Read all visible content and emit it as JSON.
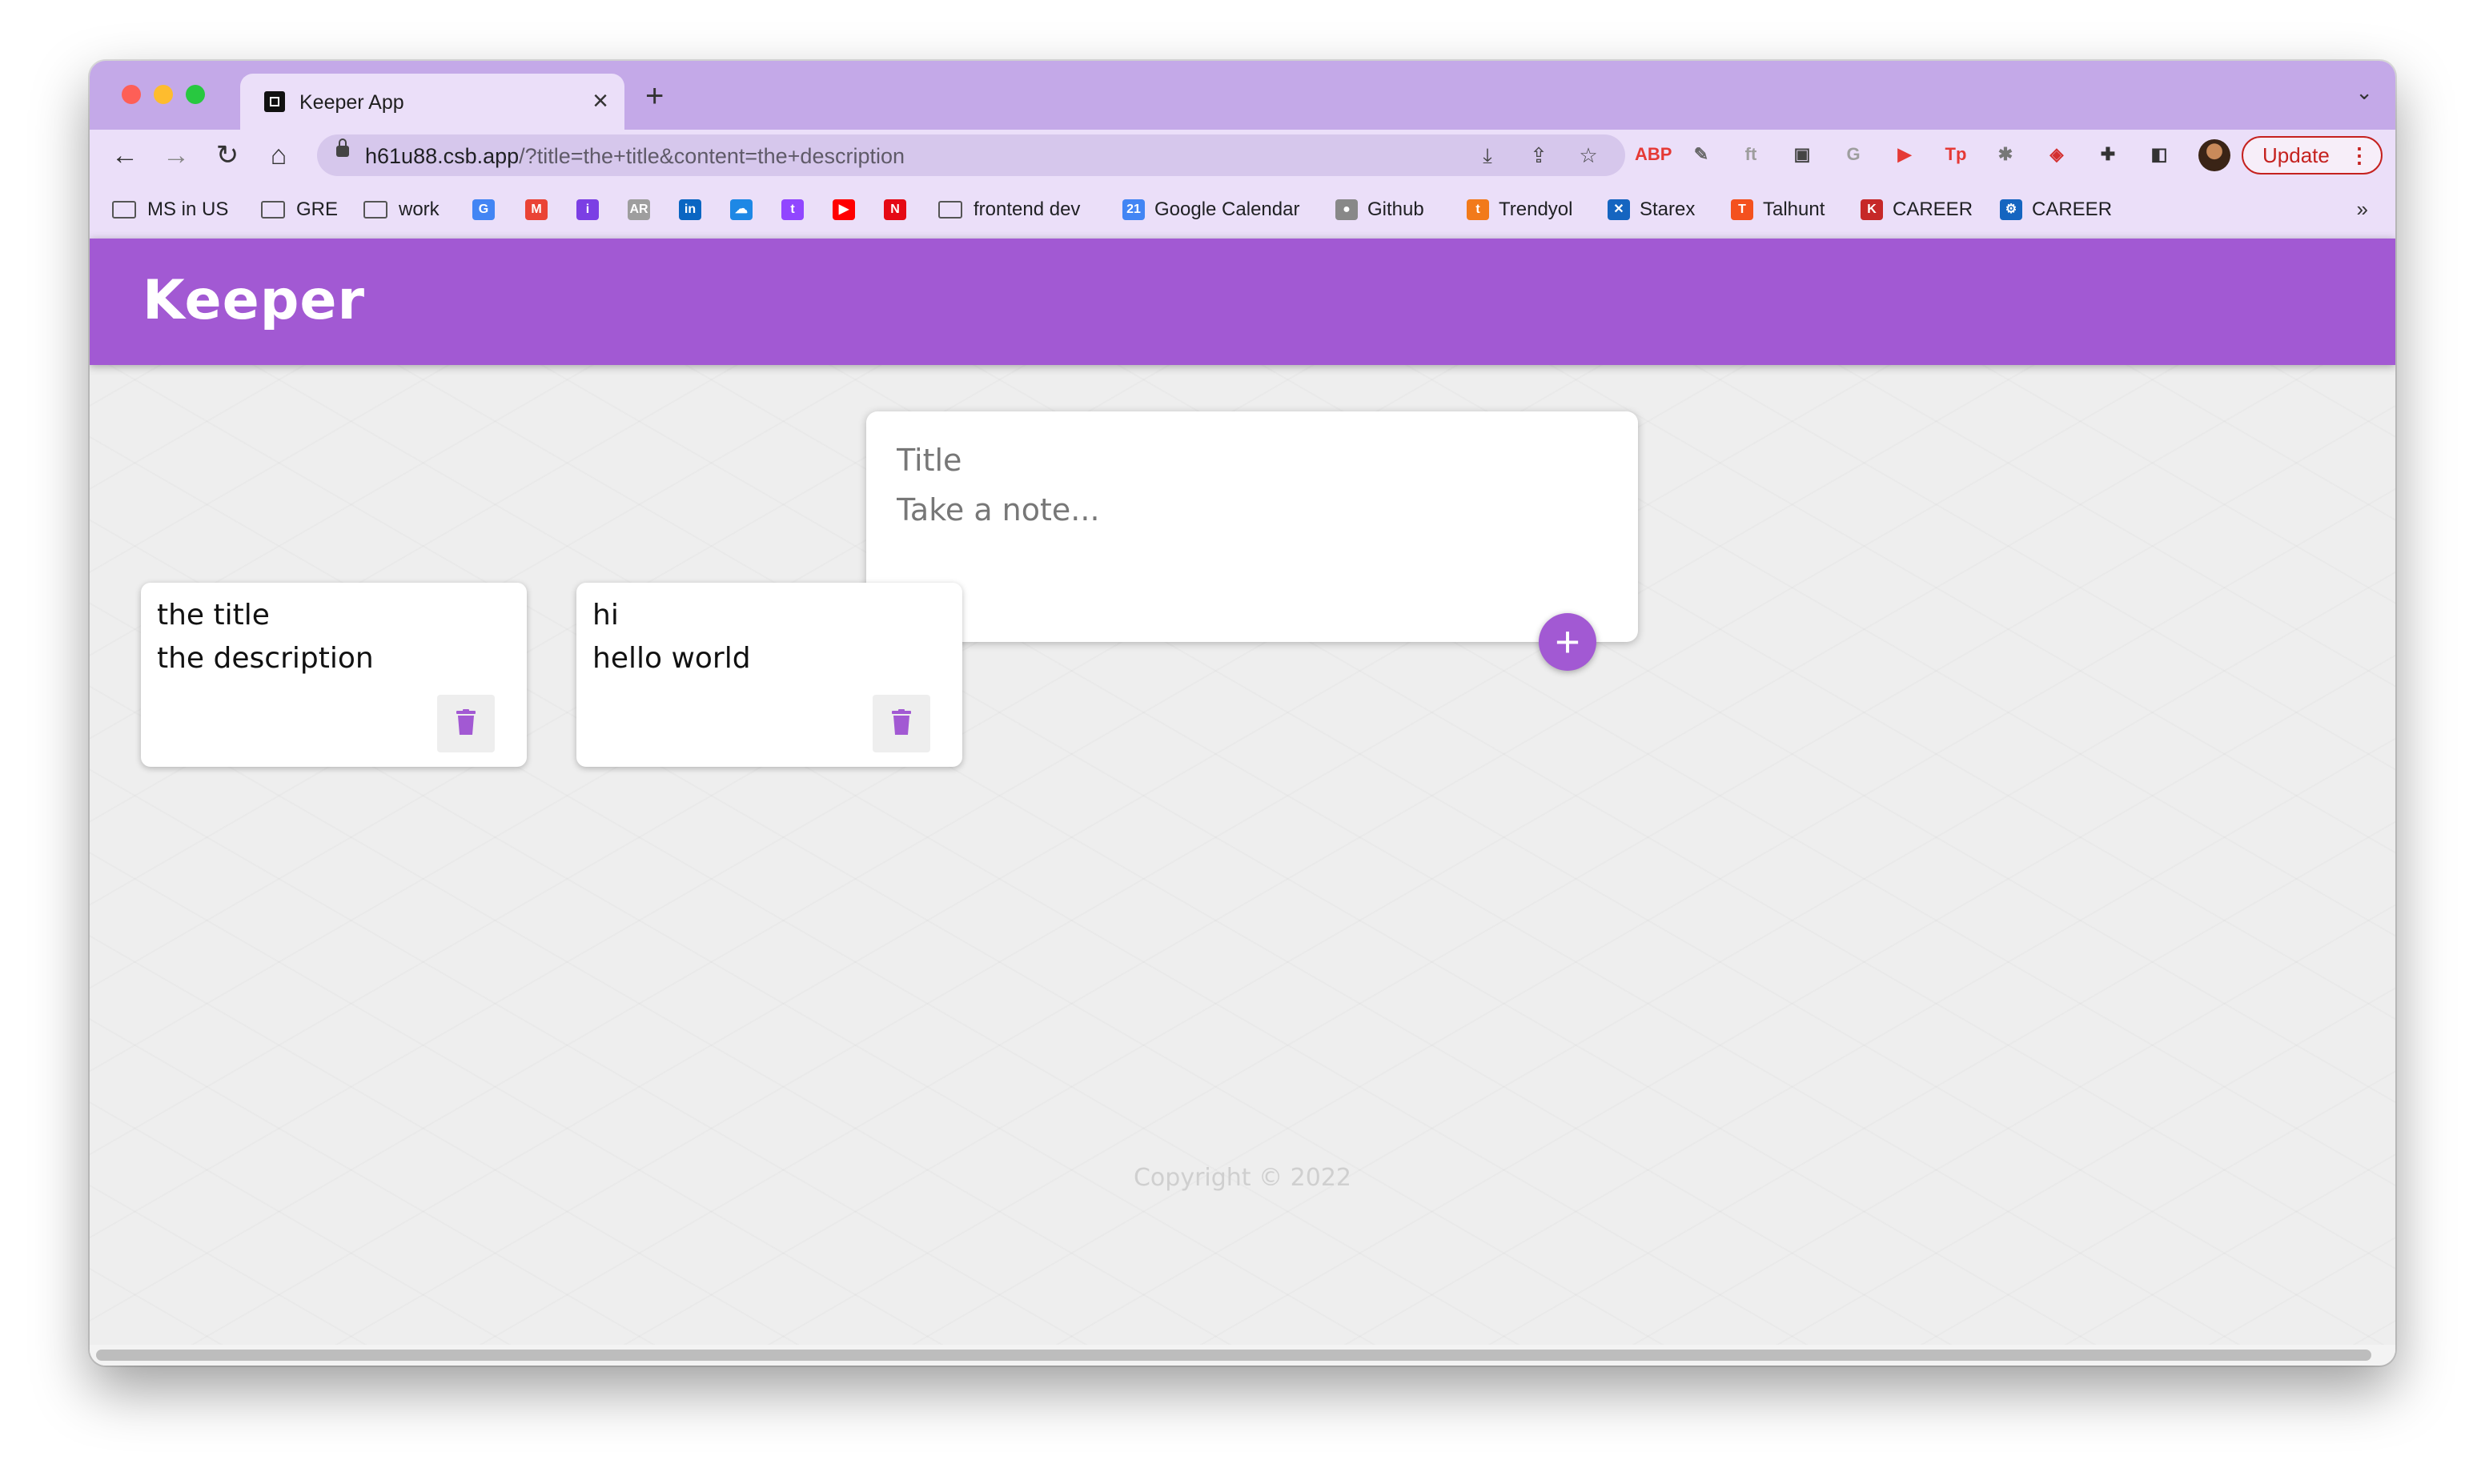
{
  "browser": {
    "tab_title": "Keeper App",
    "tab_close": "×",
    "new_tab": "+",
    "tab_list": "⌄",
    "url_host": "h61u88.csb.app",
    "url_rest": "/?title=the+title&content=the+description",
    "update_label": "Update",
    "update_menu": "⋮",
    "nav": {
      "back": "←",
      "forward": "→",
      "reload": "↻",
      "home": "⌂"
    },
    "omnibox_icons": {
      "install": "⤓",
      "share": "⇪",
      "bookmark": "☆"
    },
    "extensions": [
      {
        "name": "adblock-icon",
        "label": "ABP",
        "color": "#e53935"
      },
      {
        "name": "eyedropper-icon",
        "label": "✎",
        "color": "#666666"
      },
      {
        "name": "font-icon",
        "label": "ft",
        "color": "#9e9e9e"
      },
      {
        "name": "picture-in-picture-icon",
        "label": "▣",
        "color": "#444444"
      },
      {
        "name": "grammarly-icon",
        "label": "G",
        "color": "#9e9e9e"
      },
      {
        "name": "youtube-ext-icon",
        "label": "▶",
        "color": "#e53935"
      },
      {
        "name": "tp-icon",
        "label": "Tp",
        "color": "#e53935"
      },
      {
        "name": "bug-icon",
        "label": "✱",
        "color": "#777777"
      },
      {
        "name": "red-square-icon",
        "label": "◈",
        "color": "#d32f2f"
      },
      {
        "name": "puzzle-icon",
        "label": "✚",
        "color": "#333333"
      },
      {
        "name": "side-panel-icon",
        "label": "◧",
        "color": "#333333"
      }
    ],
    "more_bookmarks": "»",
    "bookmarks": [
      {
        "type": "folder",
        "label": "MS in US"
      },
      {
        "type": "folder",
        "label": "GRE"
      },
      {
        "type": "folder",
        "label": "work"
      },
      {
        "type": "icon",
        "icon": "G",
        "color": "#4285f4",
        "label": ""
      },
      {
        "type": "icon",
        "icon": "M",
        "color": "#ea4335",
        "label": ""
      },
      {
        "type": "icon",
        "icon": "i",
        "color": "#7b3fe4",
        "label": ""
      },
      {
        "type": "icon",
        "icon": "AR",
        "color": "#9e9e9e",
        "label": ""
      },
      {
        "type": "icon",
        "icon": "in",
        "color": "#0a66c2",
        "label": ""
      },
      {
        "type": "icon",
        "icon": "☁",
        "color": "#1e88e5",
        "label": ""
      },
      {
        "type": "icon",
        "icon": "t",
        "color": "#9146ff",
        "label": ""
      },
      {
        "type": "icon",
        "icon": "▶",
        "color": "#ff0000",
        "label": ""
      },
      {
        "type": "icon",
        "icon": "N",
        "color": "#e50914",
        "label": ""
      },
      {
        "type": "folder",
        "label": "frontend dev"
      },
      {
        "type": "icon",
        "icon": "21",
        "color": "#4285f4",
        "label": "Google Calendar"
      },
      {
        "type": "icon",
        "icon": "●",
        "color": "#888888",
        "label": "Github"
      },
      {
        "type": "icon",
        "icon": "t",
        "color": "#f27a1a",
        "label": "Trendyol"
      },
      {
        "type": "icon",
        "icon": "✕",
        "color": "#1565c0",
        "label": "Starex"
      },
      {
        "type": "icon",
        "icon": "T",
        "color": "#f4511e",
        "label": "Talhunt"
      },
      {
        "type": "icon",
        "icon": "K",
        "color": "#c62828",
        "label": "CAREER"
      },
      {
        "type": "icon",
        "icon": "⚙",
        "color": "#1565c0",
        "label": "CAREER"
      }
    ]
  },
  "app": {
    "title": "Keeper",
    "create": {
      "title_placeholder": "Title",
      "content_placeholder": "Take a note...",
      "add_label": "+"
    },
    "notes": [
      {
        "title": "the title",
        "content": "the description"
      },
      {
        "title": "hi",
        "content": "hello world"
      }
    ],
    "footer": "Copyright © 2022",
    "accent": "#a259d3"
  }
}
